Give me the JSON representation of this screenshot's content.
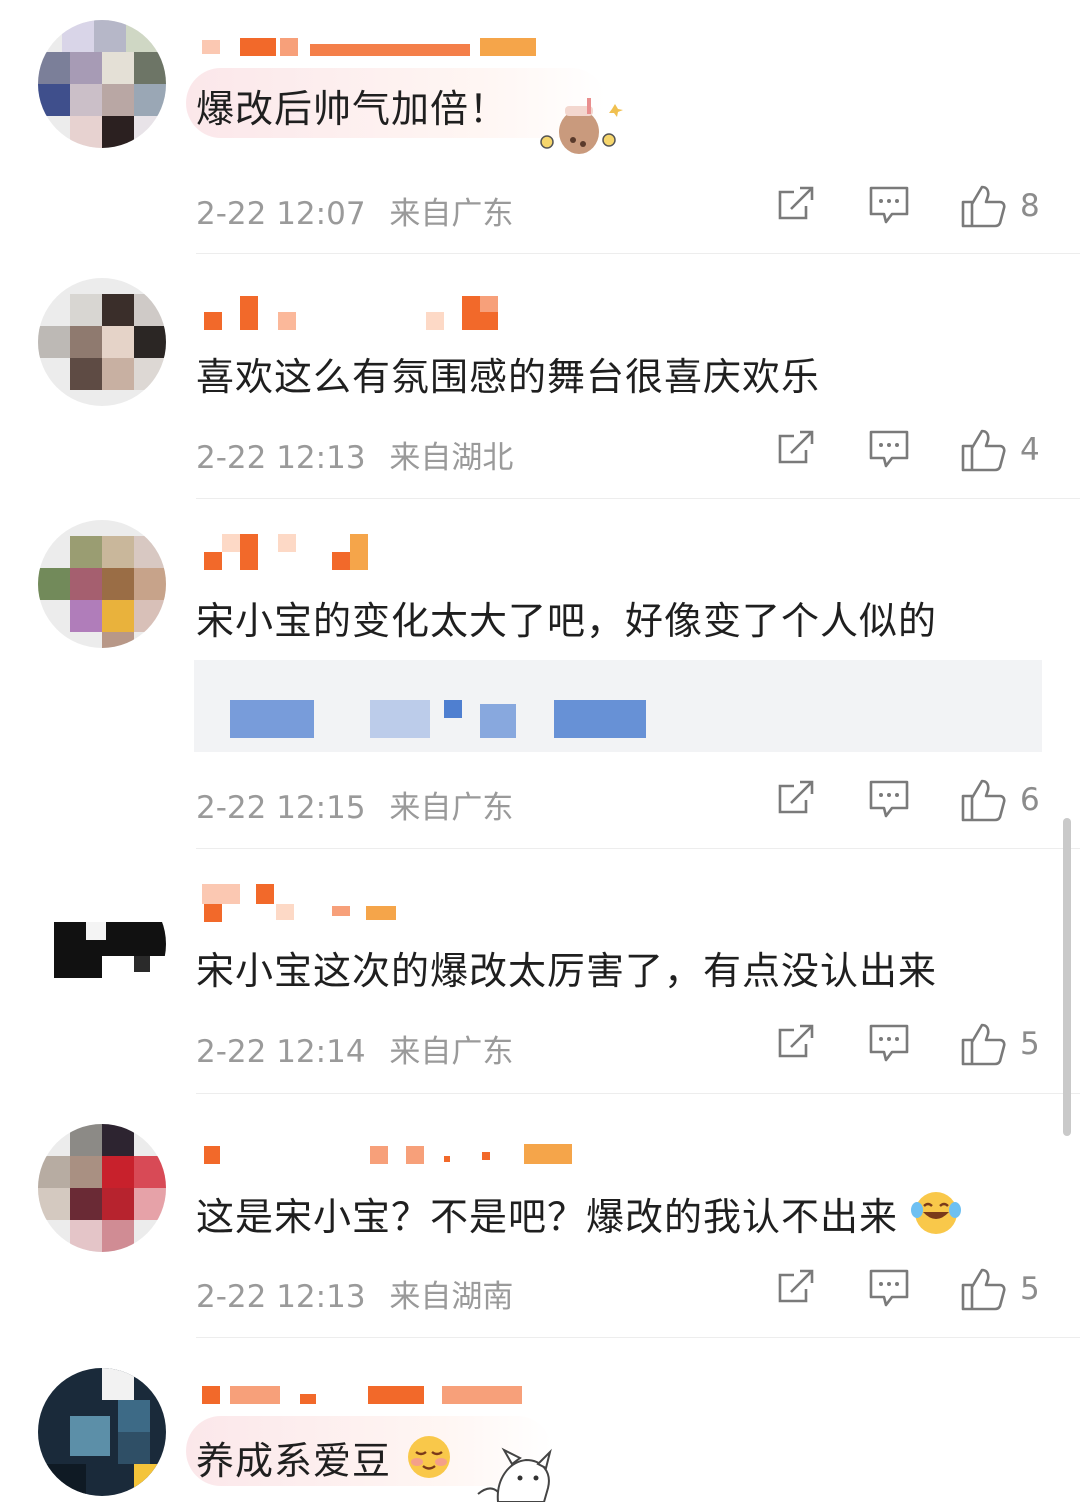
{
  "comments": [
    {
      "text": "爆改后帅气加倍！",
      "time": "2-22 12:07",
      "location": "来自广东",
      "likes": "8"
    },
    {
      "text": "喜欢这么有氛围感的舞台很喜庆欢乐",
      "time": "2-22 12:13",
      "location": "来自湖北",
      "likes": "4"
    },
    {
      "text": "宋小宝的变化太大了吧，好像变了个人似的",
      "time": "2-22 12:15",
      "location": "来自广东",
      "likes": "6"
    },
    {
      "text": "宋小宝这次的爆改太厉害了，有点没认出来",
      "time": "2-22 12:14",
      "location": "来自广东",
      "likes": "5"
    },
    {
      "text": "这是宋小宝？不是吧？爆改的我认不出来",
      "time": "2-22 12:13",
      "location": "来自湖南",
      "likes": "5"
    },
    {
      "text": "养成系爱豆",
      "time": "",
      "location": "",
      "likes": ""
    }
  ],
  "icons": {
    "share": "share-icon",
    "reply": "comment-icon",
    "like": "thumbs-up-icon"
  },
  "colors": {
    "username_orange": "#f2692a",
    "meta_gray": "#9a9a9a",
    "quote_blue": "#4f7fd0"
  }
}
